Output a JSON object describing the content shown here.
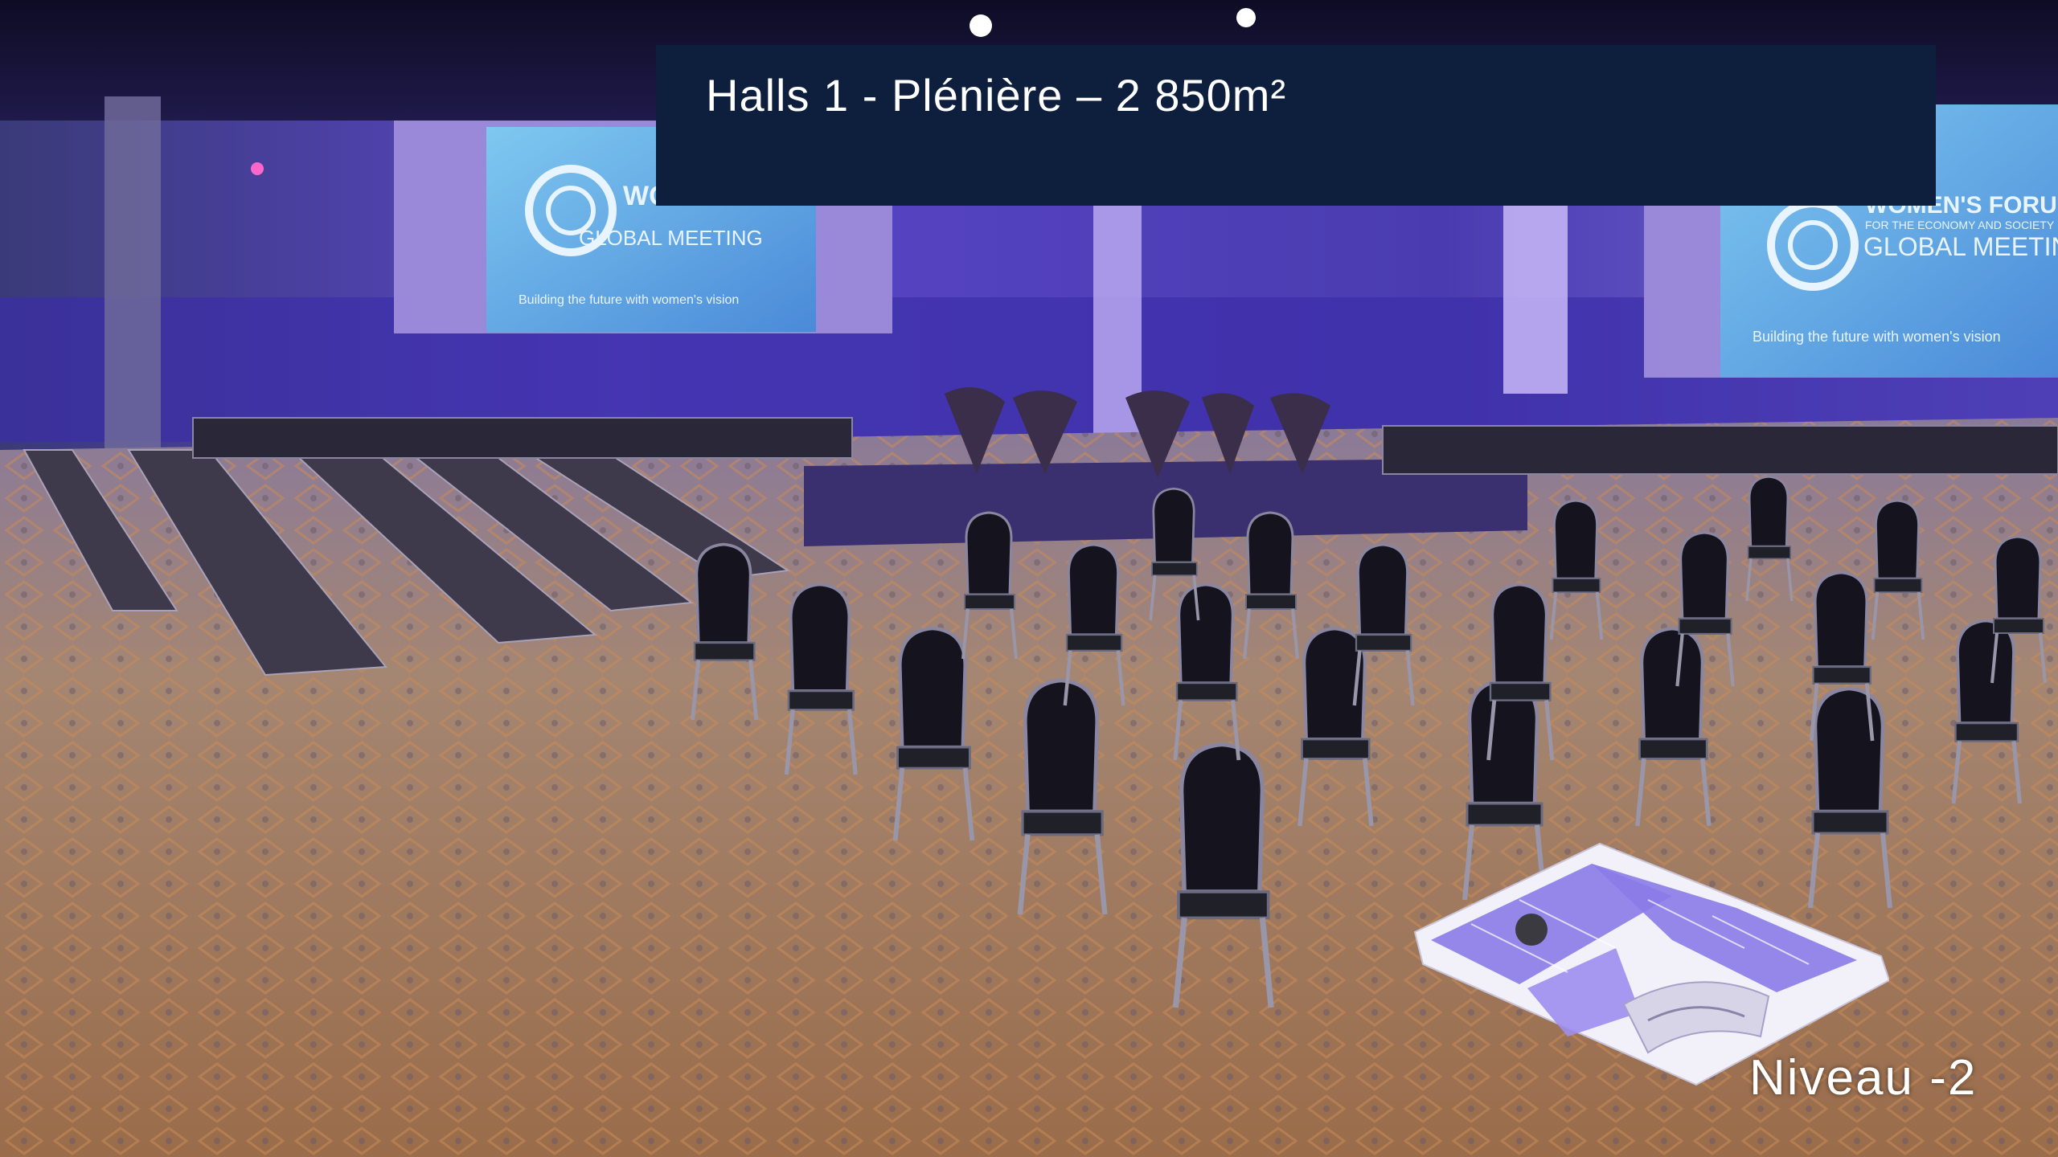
{
  "slide": {
    "title": "Halls 1 - Plénière – 2 850m²",
    "level": "Niveau -2"
  },
  "screens": {
    "left_screen": {
      "line1": "WO",
      "line2": "GLOBAL MEETING",
      "tagline": "Building the future with women's vision"
    },
    "right_screen": {
      "line1": "WOMEN'S FORUM",
      "line2": "FOR THE ECONOMY AND SOCIETY",
      "line3": "GLOBAL MEETING",
      "tagline": "Building the future with women's vision"
    }
  },
  "colors": {
    "banner": "#0d1f3c",
    "hall_light": "#6a4fd8",
    "floorplan_highlight": "#8b7be8",
    "carpet": "#b08060"
  }
}
